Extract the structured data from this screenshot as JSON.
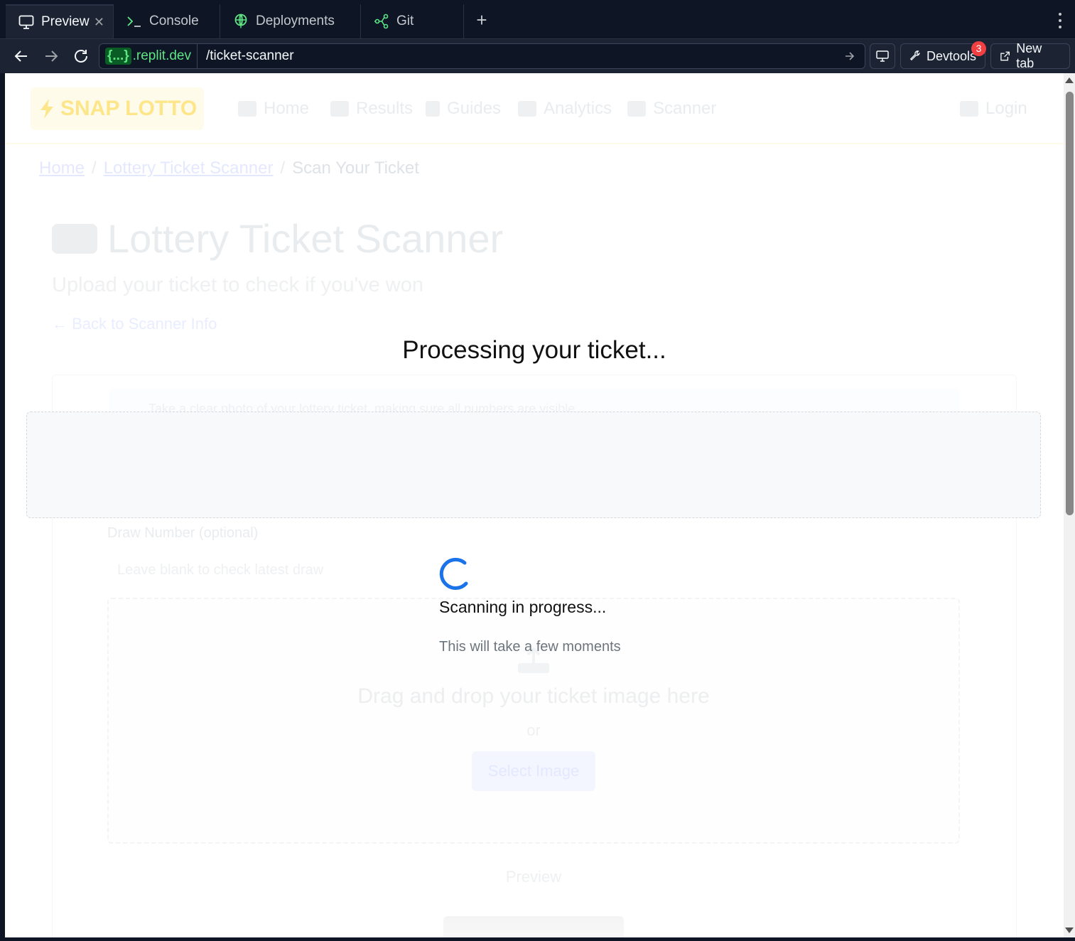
{
  "tabs": [
    {
      "label": "Preview",
      "icon": "monitor-icon",
      "active": true
    },
    {
      "label": "Console",
      "icon": "terminal-icon",
      "active": false
    },
    {
      "label": "Deployments",
      "icon": "globe-icon",
      "active": false
    },
    {
      "label": "Git",
      "icon": "git-branch-icon",
      "active": false
    }
  ],
  "url": {
    "badge": "{...}",
    "domain": ".replit.dev",
    "path": "/ticket-scanner"
  },
  "toolbar": {
    "devtools_label": "Devtools",
    "devtools_badge": "3",
    "new_tab_label": "New tab"
  },
  "site": {
    "logo": "SNAP LOTTO",
    "nav": [
      "Home",
      "Results",
      "Guides",
      "Analytics",
      "Scanner"
    ],
    "login": "Login",
    "breadcrumbs": [
      "Home",
      "Lottery Ticket Scanner",
      "Scan Your Ticket"
    ],
    "title": "Lottery Ticket Scanner",
    "subtitle": "Upload your ticket to check if you've won",
    "back_link": "Back to Scanner Info",
    "info_text": "Take a clear photo of your lottery ticket, making sure all numbers are visible.",
    "draw_label": "Draw Number (optional)",
    "draw_placeholder": "Leave blank to check latest draw",
    "dropzone_text": "Drag and drop your ticket image here",
    "dropzone_or": "or",
    "select_button": "Select Image",
    "preview_label": "Preview"
  },
  "overlay": {
    "title": "Processing your ticket...",
    "status": "Scanning in progress...",
    "note": "This will take a few moments"
  },
  "colors": {
    "chrome_bg": "#0e1525",
    "url_green": "#5ee584",
    "badge_red": "#f23f42",
    "spinner_blue": "#1a73e8"
  }
}
